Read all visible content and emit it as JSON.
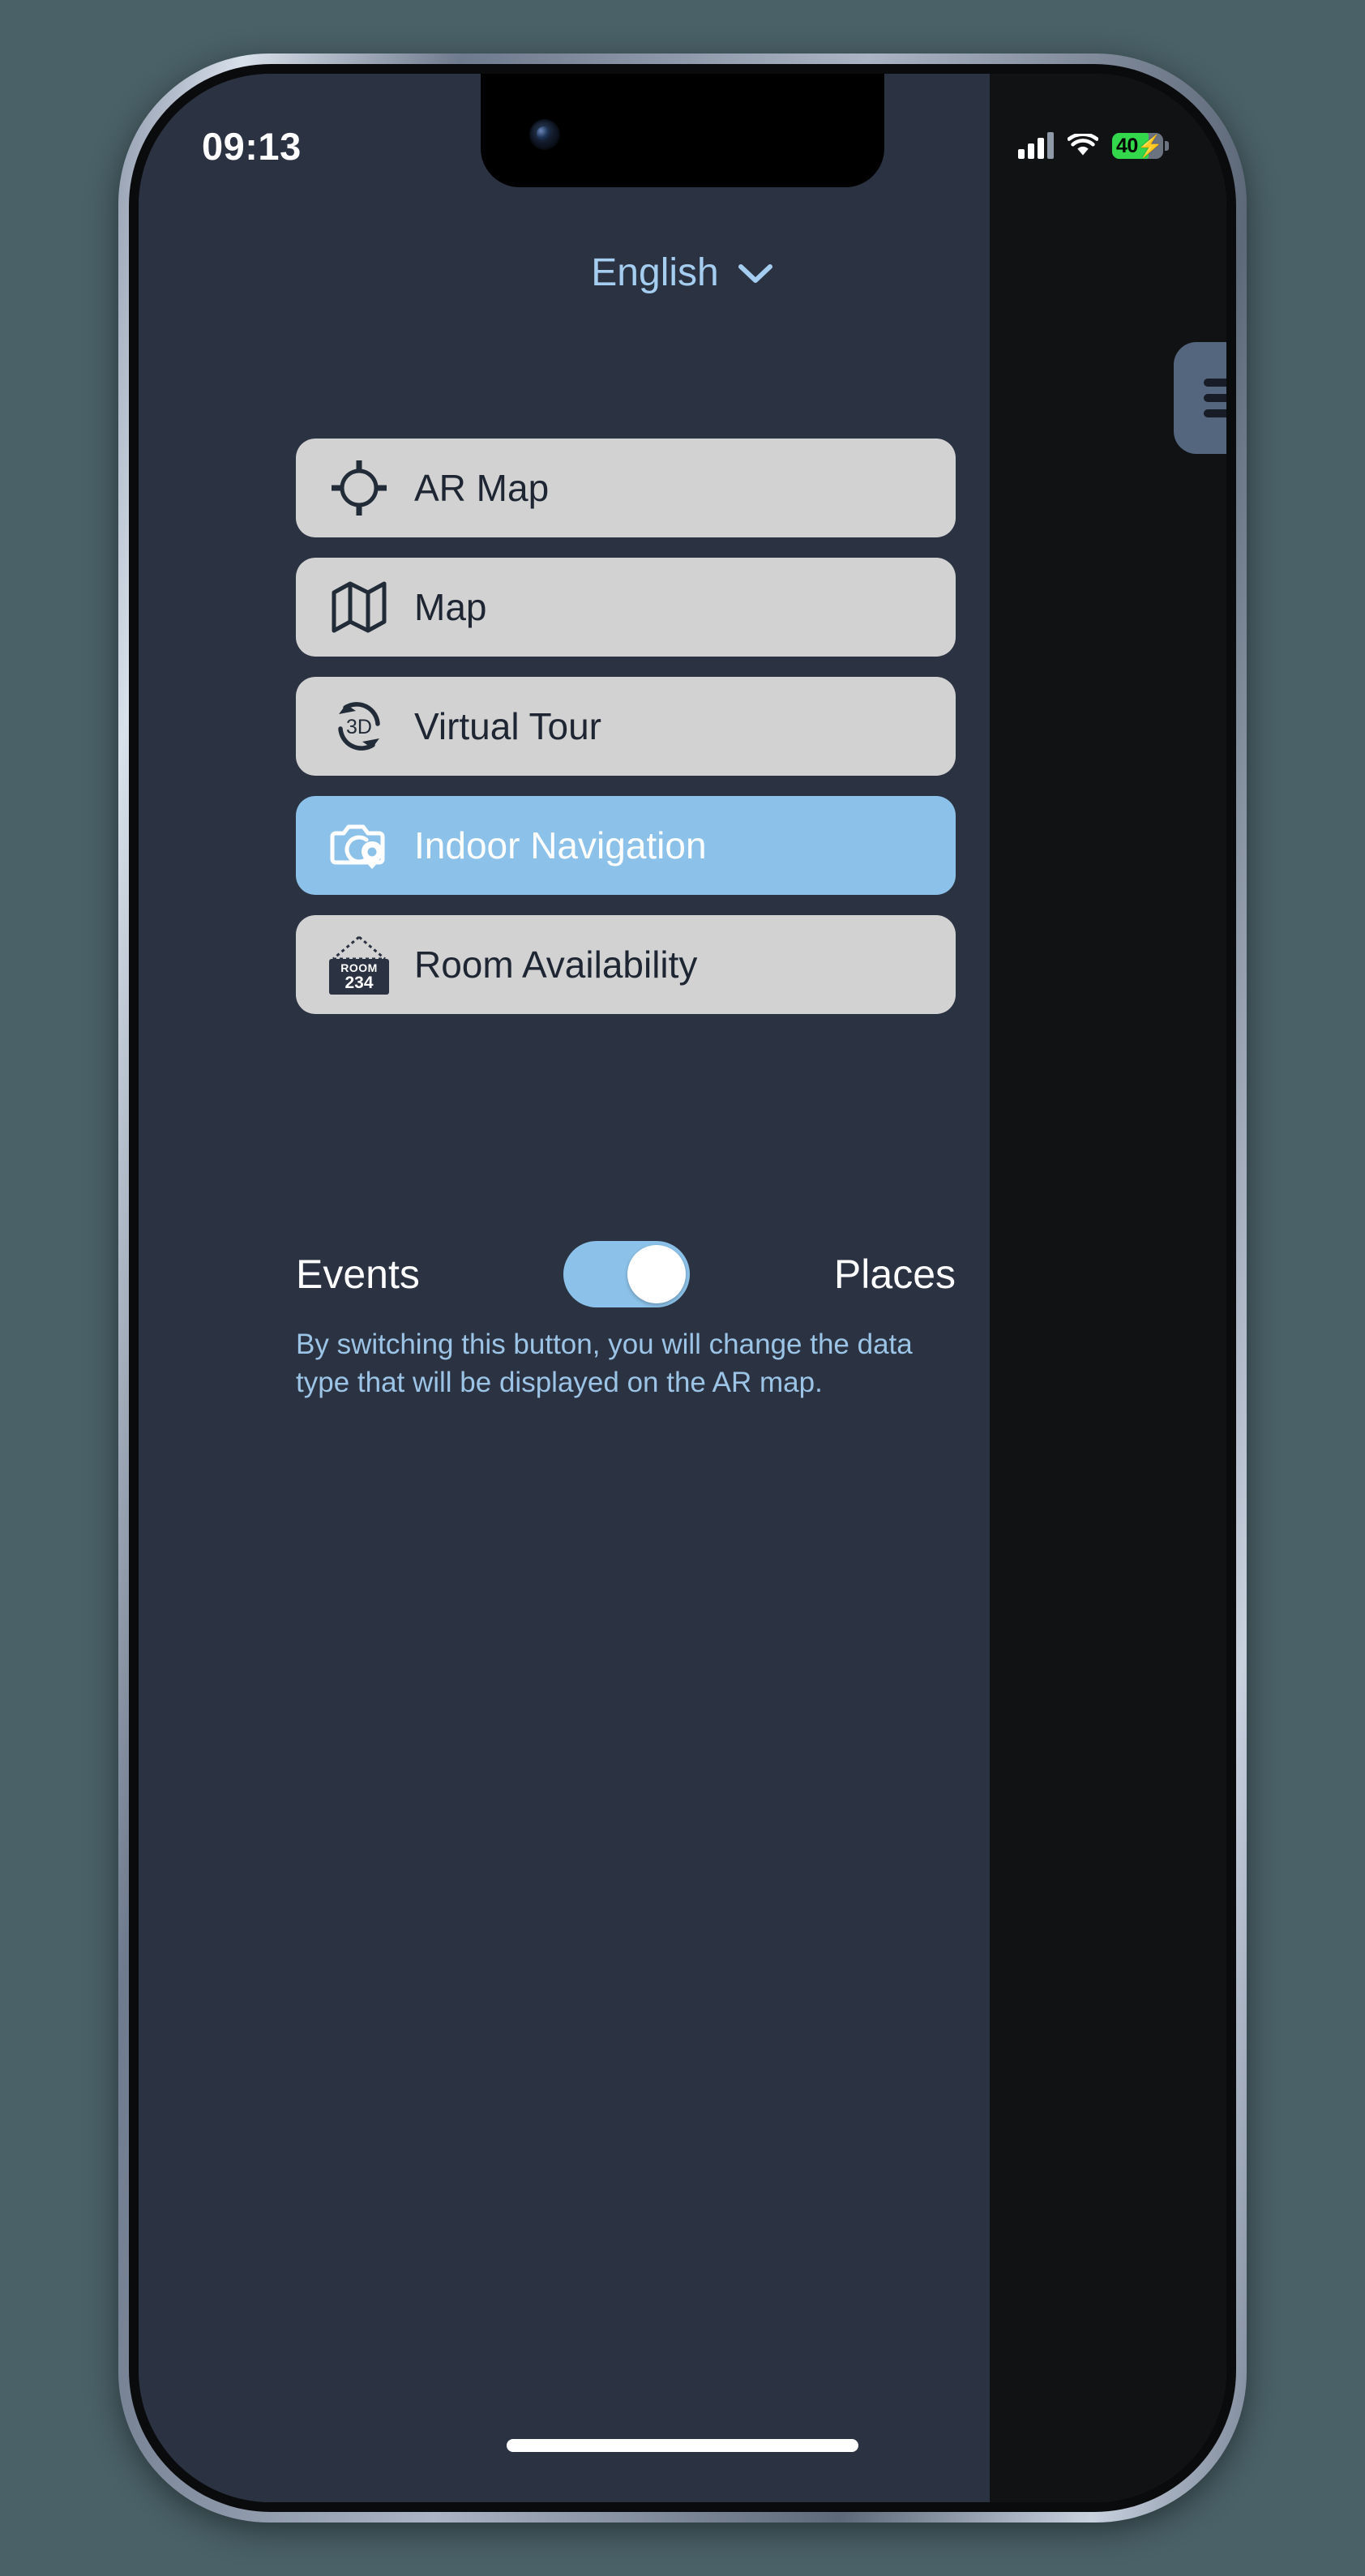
{
  "status_bar": {
    "time": "09:13",
    "battery_percent": "40",
    "battery_bolt": "⚡",
    "signal_icon": "cellular-signal-icon",
    "wifi_icon": "wifi-icon",
    "battery_icon": "battery-charging-icon"
  },
  "language": {
    "label": "English",
    "chevron_icon": "chevron-down-icon",
    "accent_color": "#a5cdf0"
  },
  "menu": {
    "items": [
      {
        "label": "AR Map",
        "icon": "crosshair-target-icon",
        "active": false
      },
      {
        "label": "Map",
        "icon": "folded-map-icon",
        "active": false
      },
      {
        "label": "Virtual Tour",
        "icon": "3d-rotate-icon",
        "active": false
      },
      {
        "label": "Indoor Navigation",
        "icon": "camera-location-pin-icon",
        "active": true
      },
      {
        "label": "Room Availability",
        "icon": "room-sign-icon",
        "active": false
      }
    ],
    "room_sign_line1": "ROOM",
    "room_sign_line2": "234",
    "rotate_badge": "3D",
    "inactive_bg": "#d2d2d2",
    "active_bg": "#8cc2e9",
    "label_color": "#1f2633",
    "active_label_color": "#ffffff"
  },
  "data_type_toggle": {
    "left_label": "Events",
    "right_label": "Places",
    "state": "on",
    "track_color": "#8cc2e9",
    "hint": "By switching this button, you will change the data type that will be displayed on the AR map."
  },
  "drawer": {
    "toggle_icon": "menu-indent-arrow-icon",
    "toggle_bg": "#54657e"
  },
  "home_screen_tiles": [
    {
      "name": "maps-app-tile",
      "icon": "folded-map-icon",
      "bg": "#1e3567"
    },
    {
      "name": "safari-app-tile",
      "icon": "compass-icon",
      "bg": "#8a4433"
    }
  ],
  "home_indicator": "home-indicator-bar"
}
